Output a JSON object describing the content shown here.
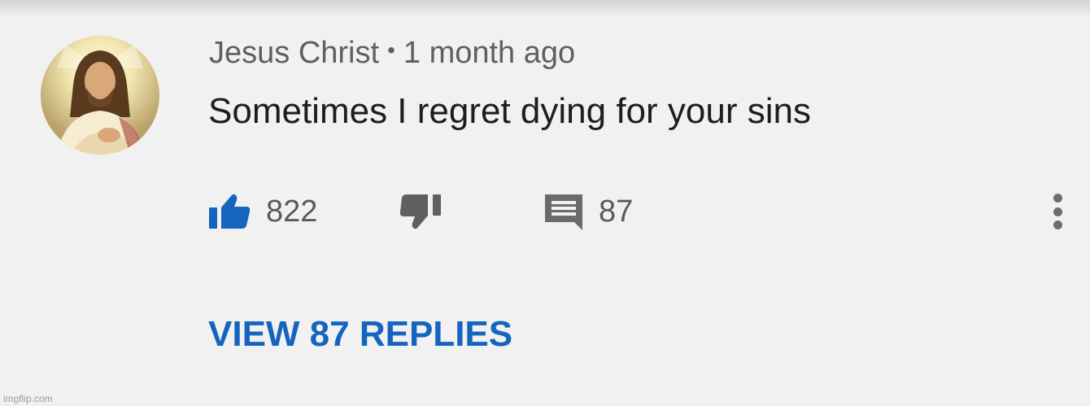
{
  "comment": {
    "author": "Jesus Christ",
    "separator": "•",
    "timestamp": "1 month ago",
    "text": "Sometimes I regret dying for your sins",
    "avatar_icon": "jesus-portrait-avatar"
  },
  "actions": {
    "like_icon": "thumbs-up-icon",
    "like_count": "822",
    "like_state": "active",
    "like_color": "#1565c0",
    "dislike_icon": "thumbs-down-icon",
    "reply_icon": "comment-icon",
    "reply_count": "87",
    "more_icon": "more-vertical-icon"
  },
  "replies": {
    "label": "VIEW 87 REPLIES",
    "color": "#1565c0"
  },
  "watermark": "imgflip.com"
}
